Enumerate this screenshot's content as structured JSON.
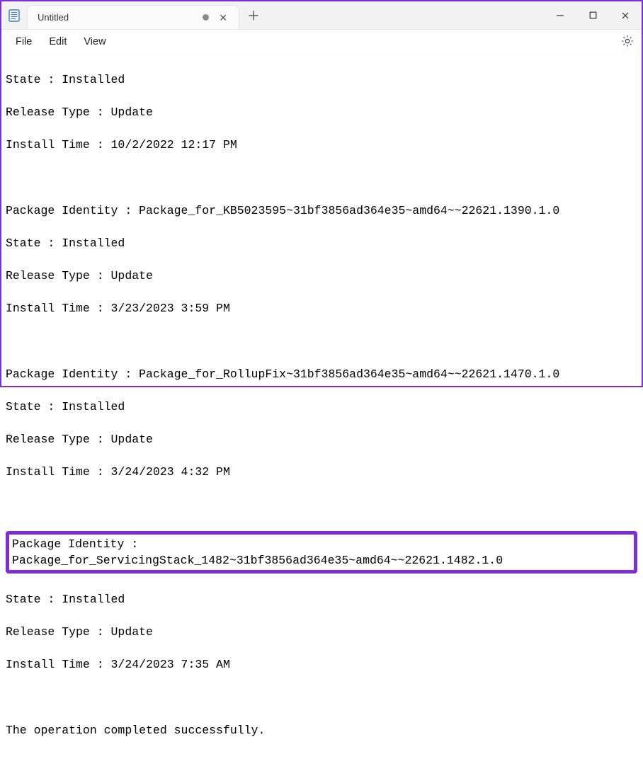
{
  "titlebar": {
    "tab_title": "Untitled"
  },
  "menubar": {
    "file": "File",
    "edit": "Edit",
    "view": "View"
  },
  "content": {
    "l01": "State : Installed",
    "l02": "Release Type : Update",
    "l03": "Install Time : 10/2/2022 12:17 PM",
    "blank1": " ",
    "l04": "Package Identity : Package_for_KB5023595~31bf3856ad364e35~amd64~~22621.1390.1.0",
    "l05": "State : Installed",
    "l06": "Release Type : Update",
    "l07": "Install Time : 3/23/2023 3:59 PM",
    "blank2": " ",
    "l08": "Package Identity : Package_for_RollupFix~31bf3856ad364e35~amd64~~22621.1470.1.0",
    "l09": "State : Installed",
    "l10": "Release Type : Update",
    "l11": "Install Time : 3/24/2023 4:32 PM",
    "blank3": " ",
    "highlighted": "Package Identity : Package_for_ServicingStack_1482~31bf3856ad364e35~amd64~~22621.1482.1.0",
    "l12": "State : Installed",
    "l13": "Release Type : Update",
    "l14": "Install Time : 3/24/2023 7:35 AM",
    "blank4": " ",
    "l15": "The operation completed successfully."
  }
}
